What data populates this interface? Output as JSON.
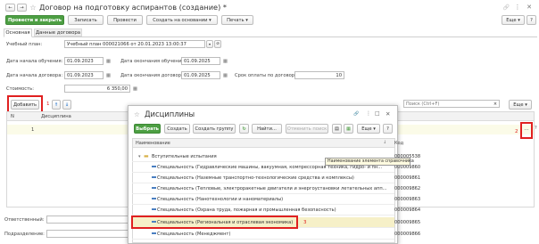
{
  "titlebar": {
    "nav_back": "←",
    "nav_forward": "→",
    "star": "☆",
    "title": "Договор на подготовку аспирантов (создание) *",
    "link_icon": "🔗",
    "menu_icon": "⋮",
    "close": "✕"
  },
  "toolbar": {
    "post_close": "Провести и закрыть",
    "save": "Записать",
    "post": "Провести",
    "create_based": "Создать на основании",
    "create_based_arrow": "▾",
    "print": "Печать",
    "print_arrow": "▾",
    "more": "Еще",
    "more_arrow": "▾",
    "help": "?"
  },
  "tabs": [
    {
      "label": "Основная"
    },
    {
      "label": "Данные договора"
    }
  ],
  "form": {
    "plan_label": "Учебный план:",
    "plan_value": "Учебный план 000021066 от 20.01.2023 13:00:37",
    "start_study_label": "Дата начала обучения:",
    "start_study_value": "01.09.2023",
    "end_study_label": "Дата окончания обучения:",
    "end_study_value": "01.09.2025",
    "start_contract_label": "Дата начала договора:",
    "start_contract_value": "01.09.2023",
    "end_contract_label": "Дата окончания договора:",
    "end_contract_value": "01.09.2025",
    "payment_term_label": "Срок оплаты по договору:",
    "payment_term_value": "10",
    "cost_label": "Стоимость:",
    "cost_value": "6 350,00",
    "responsible_label": "Ответственный:",
    "department_label": "Подразделение:"
  },
  "table_toolbar": {
    "add": "Добавить",
    "step_one": "1",
    "up": "↑",
    "down": "↓",
    "search_placeholder": "Поиск (Ctrl+F)",
    "more": "Еще",
    "step_two": "2",
    "step_three": "3"
  },
  "table": {
    "col_n": "N",
    "col_discipline": "Дисциплина",
    "rows": [
      {
        "n": "1"
      }
    ]
  },
  "dialog": {
    "star": "☆",
    "title": "Дисциплины",
    "select": "Выбрать",
    "create": "Создать",
    "create_group": "Создать группу",
    "find": "Найти...",
    "cancel_search": "Отменить поиск",
    "more": "Еще",
    "help": "?",
    "col_name": "Наименование",
    "col_code": "Код",
    "tooltip": "Наименование элемента справочника",
    "items": [
      {
        "name": "Вступительные испытания",
        "code": "000005538"
      },
      {
        "name": "Специальность (Гидравлические машины, вакуумная, компрессорная техника, гидро- и пн...",
        "code": "000009860"
      },
      {
        "name": "Специальность (Наземные транспортно-технологические средства и комплексы)",
        "code": "000009861"
      },
      {
        "name": "Специальность (Тепловые, электроракетные двигатели и энергоустановки летательных апп...",
        "code": "000009862"
      },
      {
        "name": "Специальность (Нанотехнологии и наноматериалы)",
        "code": "000009863"
      },
      {
        "name": "Специальность (Охрана труда, пожарная и промышленная безопасность)",
        "code": "000009864"
      },
      {
        "name": "Специальность (Региональная и отраслевая экономика)",
        "code": "000009865"
      },
      {
        "name": "Специальность (Менеджмент)",
        "code": "000009866"
      }
    ]
  }
}
